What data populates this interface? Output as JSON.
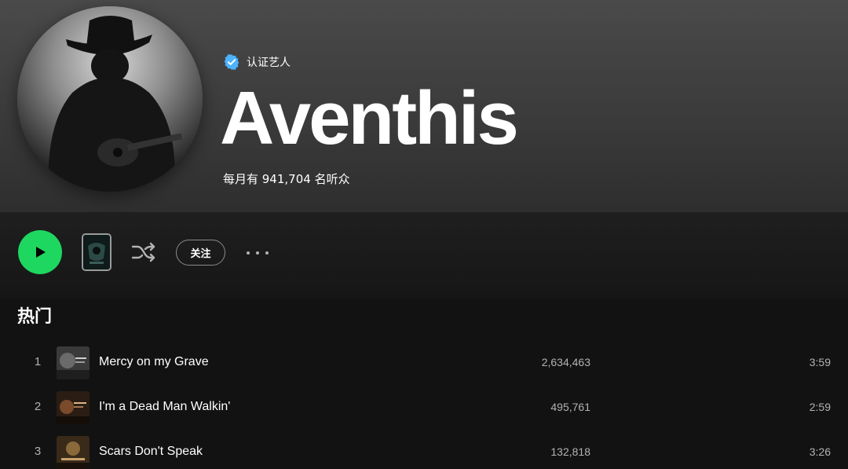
{
  "header": {
    "verified_label": "认证艺人",
    "artist_name": "Aventhis",
    "monthly_listeners": "每月有 941,704 名听众"
  },
  "actions": {
    "follow_label": "关注"
  },
  "popular": {
    "section_title": "热门",
    "tracks": [
      {
        "number": "1",
        "title": "Mercy on my Grave",
        "plays": "2,634,463",
        "duration": "3:59"
      },
      {
        "number": "2",
        "title": "I'm a Dead Man Walkin'",
        "plays": "495,761",
        "duration": "2:59"
      },
      {
        "number": "3",
        "title": "Scars Don't Speak",
        "plays": "132,818",
        "duration": "3:26"
      }
    ]
  },
  "colors": {
    "accent_green": "#1ed760",
    "verified_blue": "#4cb3ff",
    "background": "#121212",
    "muted_text": "#b3b3b3"
  },
  "icons": {
    "verified": "verified-badge-icon",
    "play": "play-icon",
    "shuffle": "shuffle-icon",
    "more": "more-options-icon"
  }
}
